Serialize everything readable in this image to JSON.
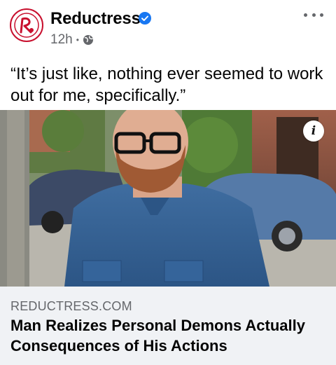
{
  "post": {
    "page_name": "Reductress",
    "time": "12h",
    "separator": "•",
    "audience_icon": "globe-icon",
    "verified_icon": "verified-badge-icon",
    "caption": "“It’s just like, nothing ever seemed to work out for me, specifically.”",
    "more_icon": "more-options-icon"
  },
  "link_preview": {
    "info_label": "i",
    "domain": "REDUCTRESS.COM",
    "headline": "Man Realizes Personal Demons Actually Consequences of His Actions"
  },
  "colors": {
    "brand_red": "#c8102e",
    "verified_blue": "#1877f2",
    "secondary_text": "#65676b",
    "link_box_bg": "#f0f2f5"
  }
}
